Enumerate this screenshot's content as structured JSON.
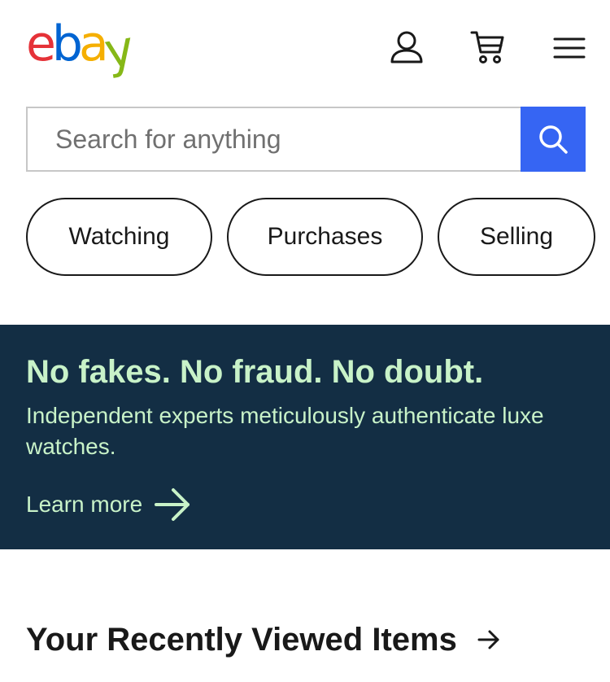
{
  "header": {
    "logo": {
      "letters": [
        "e",
        "b",
        "a",
        "y"
      ],
      "colors": [
        "#e53238",
        "#0064d2",
        "#f5af02",
        "#86b817"
      ]
    },
    "icons": [
      "user-icon",
      "cart-icon",
      "hamburger-menu-icon"
    ]
  },
  "search": {
    "placeholder": "Search for anything",
    "value": "",
    "button_icon": "search-icon",
    "button_color": "#3665f3"
  },
  "quick_links": [
    {
      "label": "Watching"
    },
    {
      "label": "Purchases"
    },
    {
      "label": "Selling"
    }
  ],
  "banner": {
    "title": "No fakes. No fraud. No doubt.",
    "text": "Independent experts meticulously authenticate luxe watches.",
    "link_label": "Learn more",
    "link_icon": "arrow-right-icon",
    "background_color": "#132e44",
    "text_color": "#c8f2c8"
  },
  "recently_viewed": {
    "title": "Your Recently Viewed Items",
    "icon": "arrow-right-icon"
  }
}
